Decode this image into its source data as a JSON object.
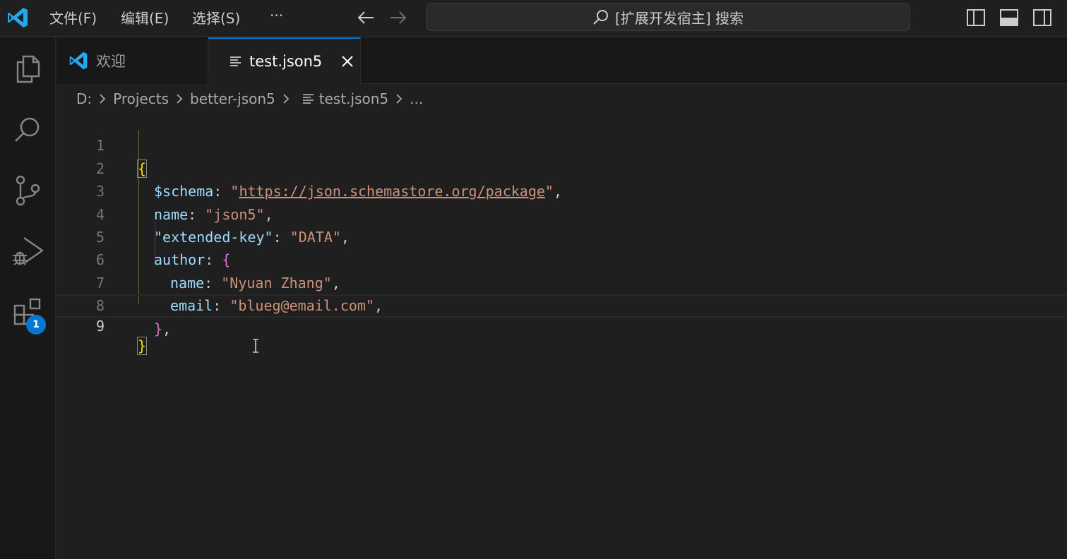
{
  "titlebar": {
    "menu": [
      "文件(F)",
      "编辑(E)",
      "选择(S)",
      "···"
    ],
    "command_center": "[扩展开发宿主] 搜索"
  },
  "activity_bar": {
    "items": [
      "explorer-icon",
      "search-icon",
      "source-control-icon",
      "run-debug-icon",
      "extensions-icon"
    ],
    "extensions_badge": "1"
  },
  "tabs": [
    {
      "label": "欢迎",
      "icon": "vscode-logo-icon",
      "active": false
    },
    {
      "label": "test.json5",
      "icon": "file-lines-icon",
      "active": true
    }
  ],
  "breadcrumb": [
    "D:",
    "Projects",
    "better-json5",
    "test.json5",
    "..."
  ],
  "editor": {
    "line_numbers": [
      "1",
      "2",
      "3",
      "4",
      "5",
      "6",
      "7",
      "8",
      "9"
    ],
    "active_line": "9",
    "tokens": {
      "l1_open": "{",
      "l2_key": "$schema",
      "l2_colon": ": ",
      "l2_q1": "\"",
      "l2_url": "https://json.schemastore.org/package",
      "l2_q2": "\"",
      "l2_comma": ",",
      "l3_key": "name",
      "l3_colon": ": ",
      "l3_val": "\"json5\"",
      "l3_comma": ",",
      "l4_key": "\"extended-key\"",
      "l4_colon": ": ",
      "l4_val": "\"DATA\"",
      "l4_comma": ",",
      "l5_key": "author",
      "l5_colon": ": ",
      "l5_open": "{",
      "l6_key": "name",
      "l6_colon": ": ",
      "l6_val": "\"Nyuan Zhang\"",
      "l6_comma": ",",
      "l7_key": "email",
      "l7_colon": ": ",
      "l7_val": "\"blueg@email.com\"",
      "l7_comma": ",",
      "l8_close": "}",
      "l8_comma": ",",
      "l9_close": "}"
    }
  },
  "colors": {
    "accent": "#0078d4",
    "key": "#9cdcfe",
    "string": "#ce9178",
    "bracket_level1": "#ffd700",
    "bracket_level2": "#da70d6"
  }
}
